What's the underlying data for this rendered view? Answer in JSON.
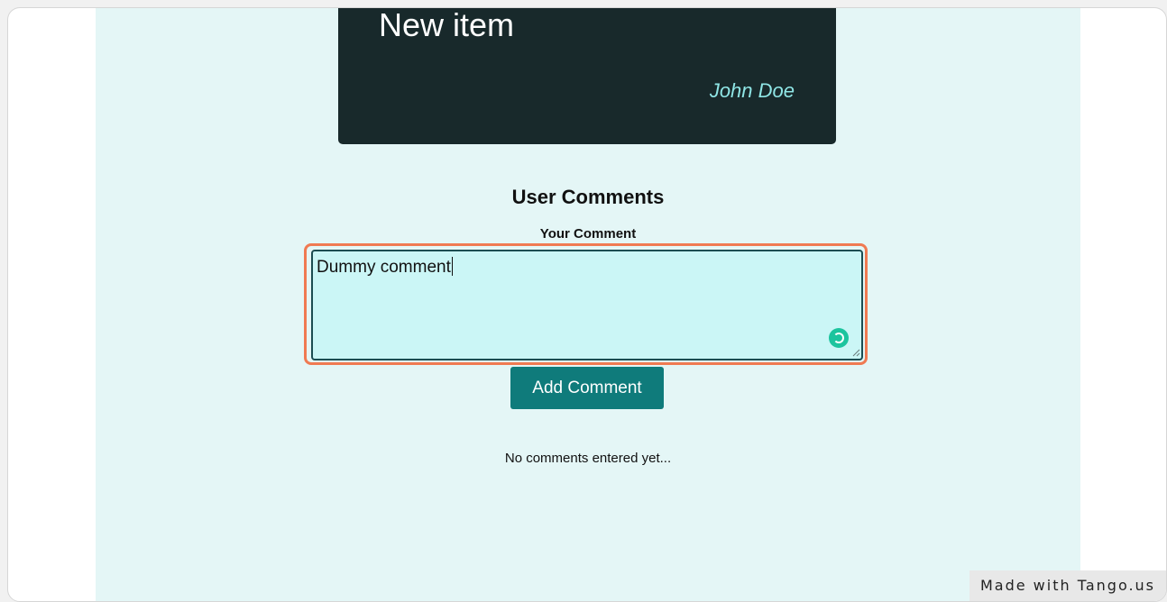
{
  "item": {
    "title": "New item",
    "author": "John Doe"
  },
  "comments": {
    "heading": "User Comments",
    "field_label": "Your Comment",
    "field_value": "Dummy comment",
    "add_button_label": "Add Comment",
    "empty_message": "No comments entered yet..."
  },
  "watermark": {
    "text": "Made with Tango.us"
  },
  "colors": {
    "page_background": "#e4f6f6",
    "card_background": "#18292b",
    "accent": "#0f7b7b",
    "highlight": "#f07a52",
    "author_text": "#8fe6e6",
    "textarea_background": "#cbf6f6"
  },
  "icons": {
    "grammar_assistant": "grammar-assistant-icon",
    "resize_handle": "resize-handle-icon"
  }
}
